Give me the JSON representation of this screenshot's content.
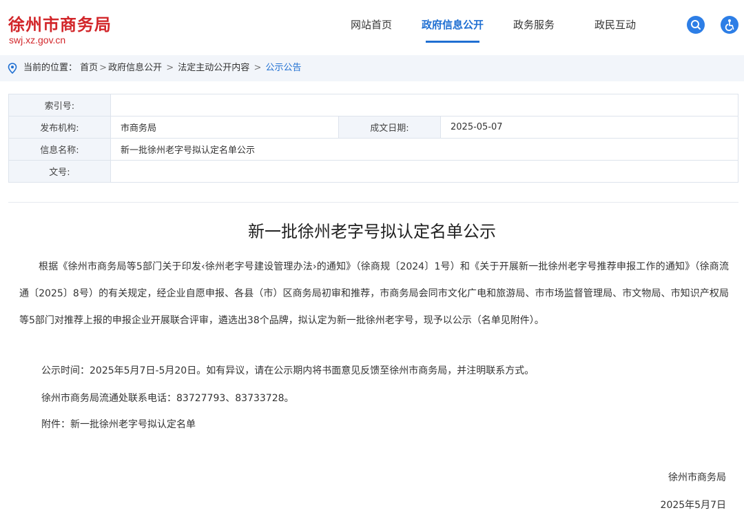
{
  "header": {
    "title": "徐州市商务局",
    "url": "swj.xz.gov.cn",
    "nav": [
      {
        "label": "网站首页",
        "active": false
      },
      {
        "label": "政府信息公开",
        "active": true
      },
      {
        "label": "政务服务",
        "active": false
      },
      {
        "label": "政民互动",
        "active": false
      }
    ],
    "icons": {
      "search": "search-icon",
      "accessibility": "accessibility-icon"
    },
    "accent_color": "#1f6fd2",
    "brand_color": "#d2262a"
  },
  "breadcrumb": {
    "prefix": "当前的位置：",
    "items": [
      "首页",
      "政府信息公开",
      "法定主动公开内容",
      "公示公告"
    ],
    "separator": ">"
  },
  "info": {
    "index_label": "索引号:",
    "index_value": "",
    "publisher_label": "发布机构:",
    "publisher_value": "市商务局",
    "date_label": "成文日期:",
    "date_value": "2025-05-07",
    "name_label": "信息名称:",
    "name_value": "新一批徐州老字号拟认定名单公示",
    "doc_no_label": "文号:",
    "doc_no_value": ""
  },
  "article": {
    "title": "新一批徐州老字号拟认定名单公示",
    "paragraph1": "根据《徐州市商务局等5部门关于印发‹徐州老字号建设管理办法›的通知》（徐商规〔2024〕1号）和《关于开展新一批徐州老字号推荐申报工作的通知》（徐商流通〔2025〕8号）的有关规定，经企业自愿申报、各县（市）区商务局初审和推荐，市商务局会同市文化广电和旅游局、市市场监督管理局、市文物局、市知识产权局等5部门对推荐上报的申报企业开展联合评审，遴选出38个品牌，拟认定为新一批徐州老字号，现予以公示（名单见附件）。",
    "notice_period": "公示时间：2025年5月7日-5月20日。如有异议，请在公示期内将书面意见反馈至徐州市商务局，并注明联系方式。",
    "contact": "徐州市商务局流通处联系电话：83727793、83733728。",
    "attachment": "附件：新一批徐州老字号拟认定名单",
    "signature_org": "徐州市商务局",
    "signature_date": "2025年5月7日"
  }
}
